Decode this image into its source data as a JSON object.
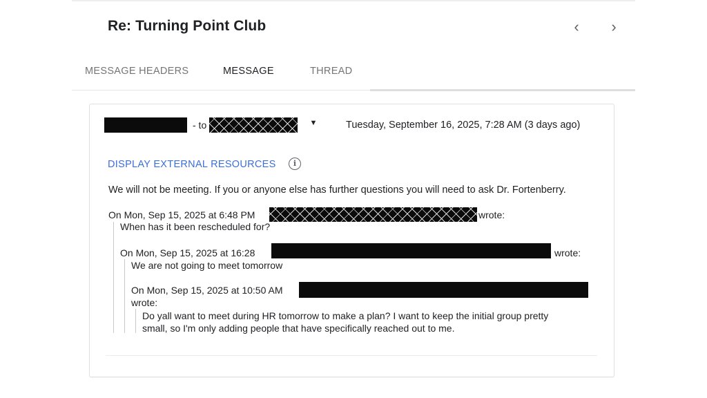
{
  "header": {
    "subject": "Re: Turning Point Club",
    "prev_icon": "chevron-left-icon",
    "next_icon": "chevron-right-icon"
  },
  "tabs": [
    {
      "label": "MESSAGE HEADERS",
      "active": false
    },
    {
      "label": "MESSAGE",
      "active": true
    },
    {
      "label": "THREAD",
      "active": false
    }
  ],
  "message": {
    "to_label": "- to",
    "date": "Tuesday, September 16, 2025, 7:28 AM (3 days ago)",
    "external_resources_label": "DISPLAY EXTERNAL RESOURCES",
    "info_icon": "info-icon",
    "body": "We will not be meeting. If you or anyone else has further questions you will need to ask Dr. Fortenberry.",
    "quotes": [
      {
        "attribution_prefix": "On Mon, Sep 15, 2025 at 6:48 PM",
        "attribution_suffix": "wrote:",
        "body": "When has it been rescheduled for?"
      },
      {
        "attribution_prefix": "On Mon, Sep 15, 2025 at 16:28",
        "attribution_suffix": "wrote:",
        "body": "We are not going to meet tomorrow"
      },
      {
        "attribution_prefix": "On Mon, Sep 15, 2025 at 10:50 AM",
        "attribution_suffix": "wrote:",
        "body_lines": [
          "Do yall want to meet during HR tomorrow to make a plan? I want to keep the initial group pretty",
          "small, so I'm only adding people that have specifically reached out to me."
        ]
      }
    ]
  },
  "colors": {
    "link": "#3c6fd8",
    "redaction": "#0b0b0b"
  }
}
